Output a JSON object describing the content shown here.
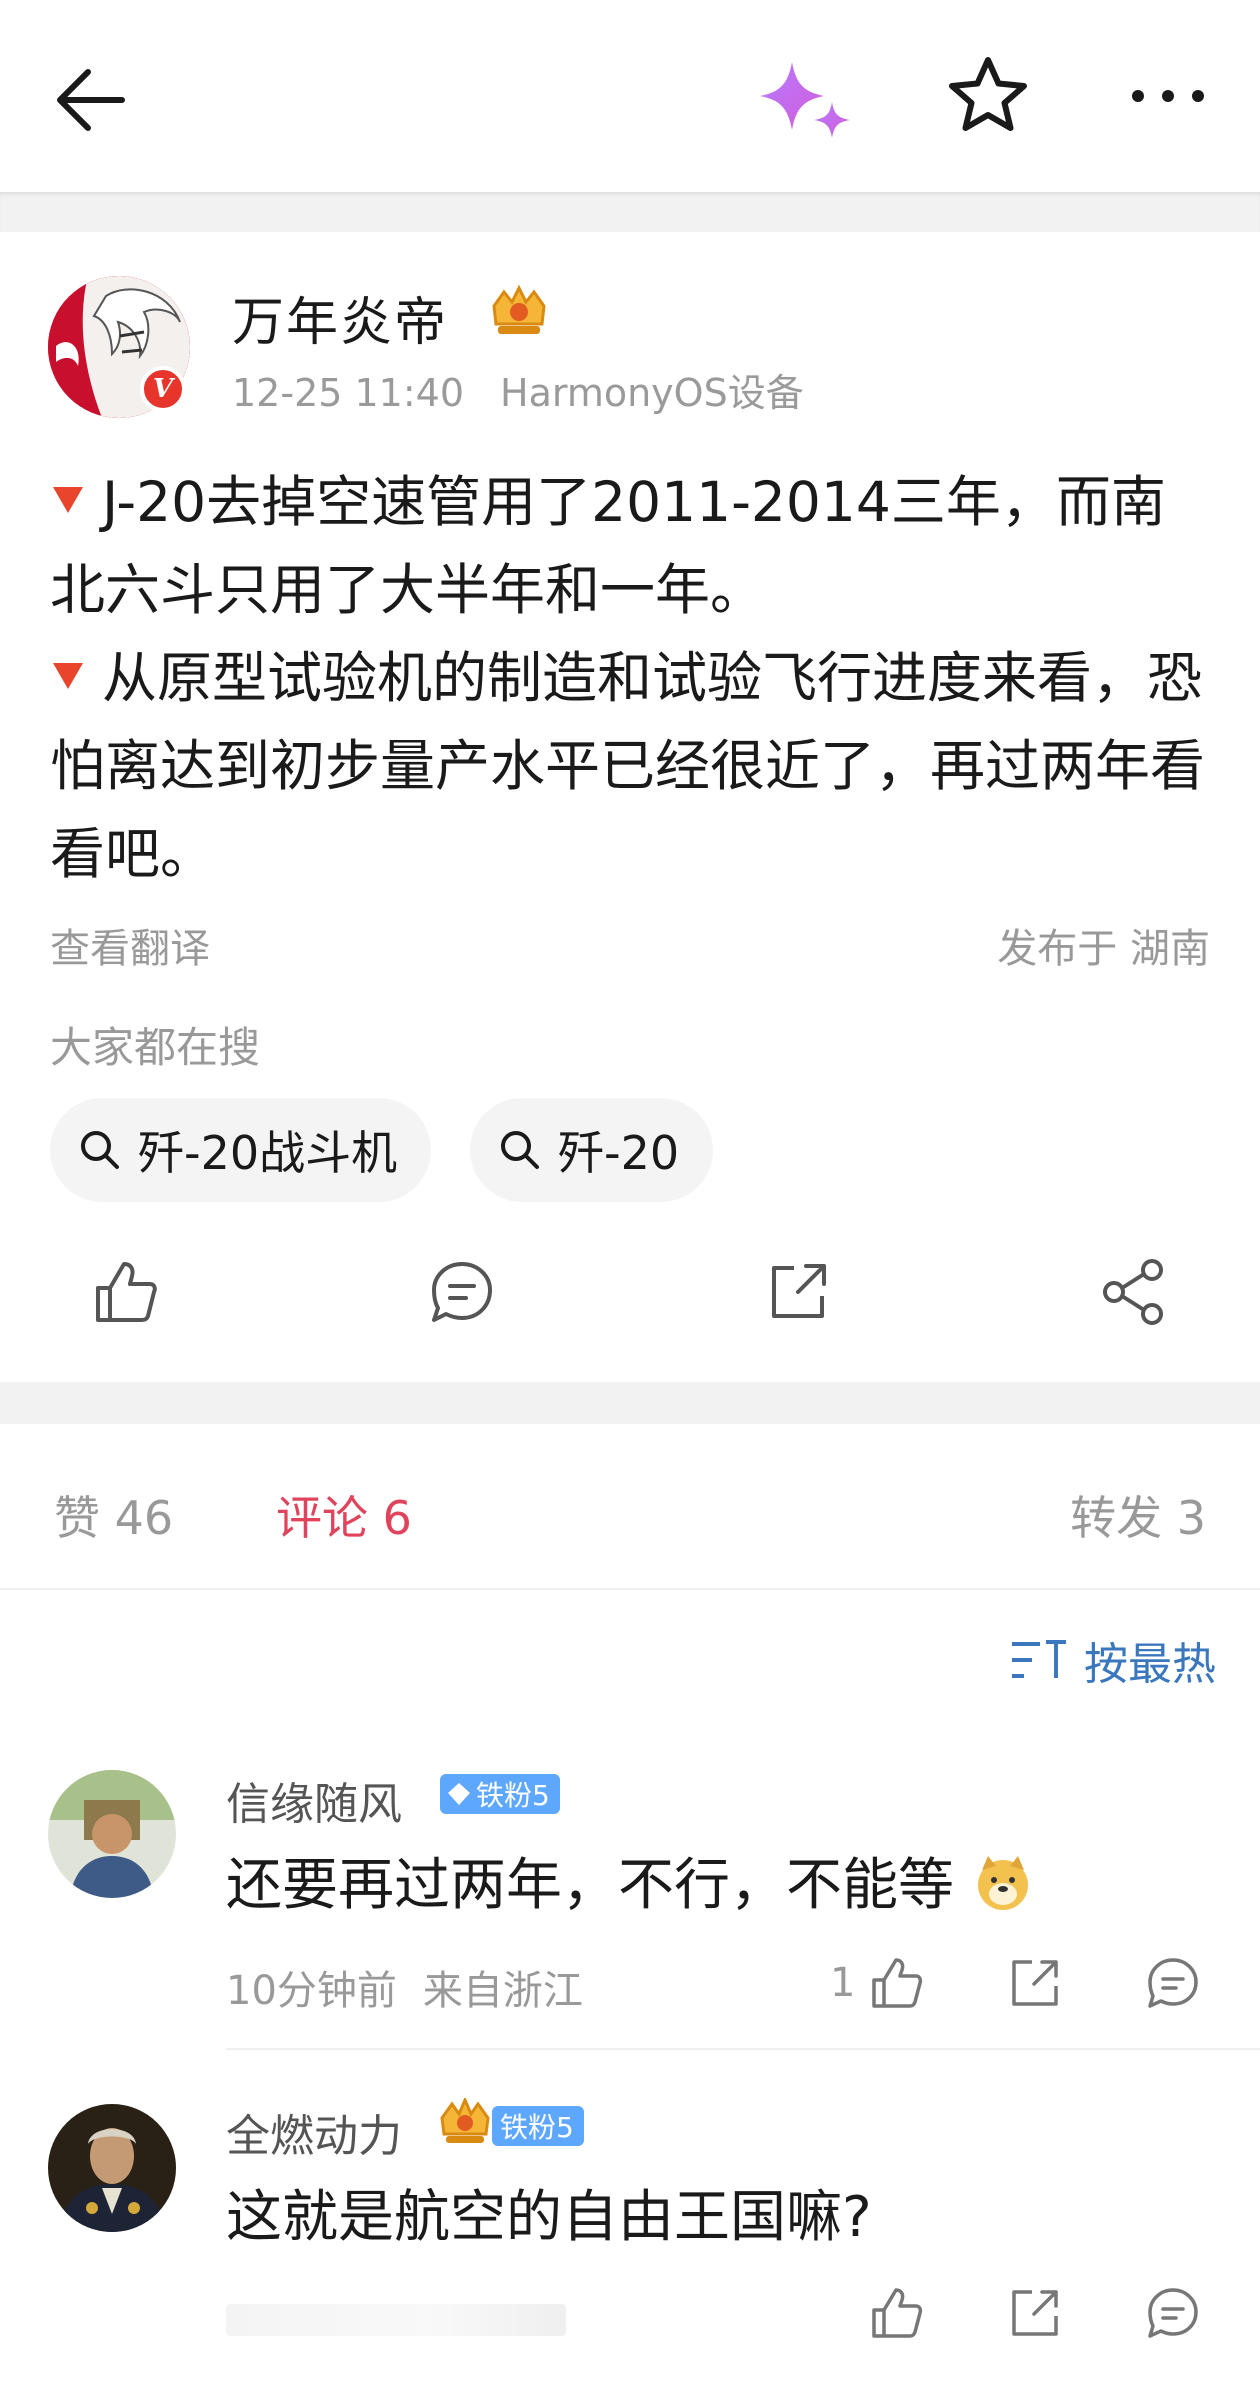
{
  "topbar": {
    "back_icon": "arrow-left-icon",
    "ai_icon": "sparkle-icon",
    "favorite_icon": "star-icon",
    "more_icon": "more-dots-icon"
  },
  "post": {
    "author": "万年炎帝",
    "verified_badge": "V",
    "time": "12-25 11:40",
    "device": "HarmonyOS设备",
    "paragraphs": [
      "J-20去掉空速管用了2011-2014三年，而南北六斗只用了大半年和一年。",
      "从原型试验机的制造和试验飞行进度来看，恐怕离达到初步量产水平已经很近了，再过两年看看吧。"
    ],
    "translate_label": "查看翻译",
    "location": "发布于 湖南",
    "searching_label": "大家都在搜",
    "search_chips": [
      "歼-20战斗机",
      "歼-20"
    ]
  },
  "tabs": {
    "likes": "赞 46",
    "comments": "评论 6",
    "reposts": "转发 3"
  },
  "sort_label": "按最热",
  "comments": [
    {
      "name": "信缘随风",
      "fan_badge": "铁粉5",
      "text": "还要再过两年，不行，不能等",
      "time": "10分钟前",
      "location": "来自浙江",
      "likes": "1"
    },
    {
      "name": "全燃动力",
      "fan_badge": "铁粉5",
      "text": "这就是航空的自由王国嘛?"
    }
  ],
  "colors": {
    "accent": "#e0445c",
    "link": "#3b77bd",
    "fan_badge": "#5ea7ff",
    "verified": "#e8352b"
  }
}
